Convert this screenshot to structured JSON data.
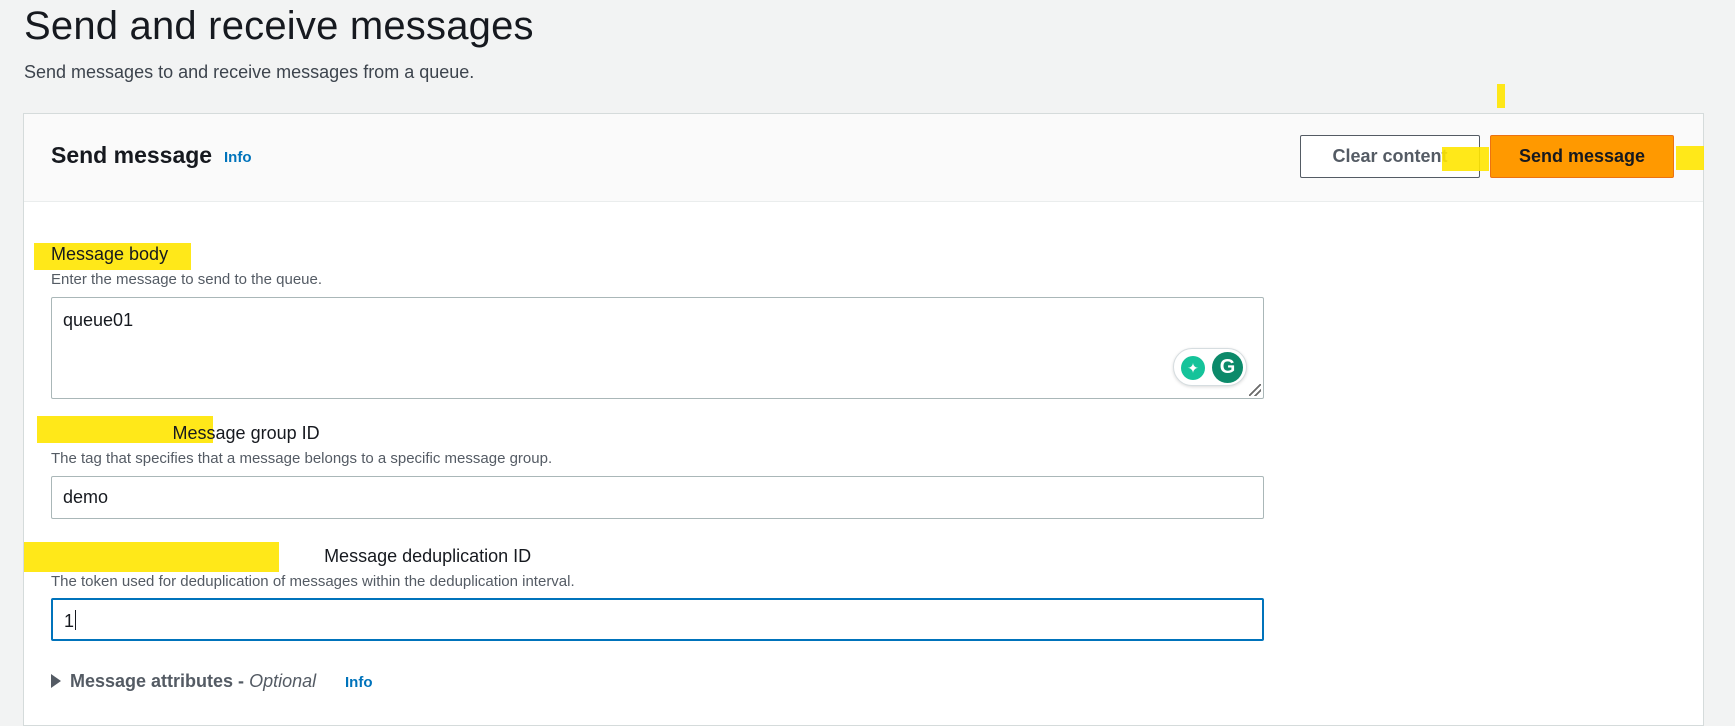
{
  "page": {
    "title": "Send and receive messages",
    "subtitle": "Send messages to and receive messages from a queue."
  },
  "panel": {
    "title": "Send message",
    "info_label": "Info",
    "clear_button": "Clear content",
    "send_button": "Send message"
  },
  "fields": {
    "message_body": {
      "label": "Message body",
      "description": "Enter the message to send to the queue.",
      "value": "queue01"
    },
    "group_id": {
      "label": "Message group ID",
      "description": "The tag that specifies that a message belongs to a specific message group.",
      "value": "demo"
    },
    "dedup_id": {
      "label": "Message deduplication ID",
      "description": "The token used for deduplication of messages within the deduplication interval.",
      "value": "1"
    }
  },
  "attributes": {
    "label": "Message attributes - ",
    "optional": "Optional",
    "info_label": "Info"
  },
  "icons": {
    "grammarly_suggest": "lightbulb-icon",
    "grammarly_logo": "grammarly-icon",
    "expand": "caret-right-icon"
  },
  "colors": {
    "accent": "#ff9900",
    "link": "#0073bb",
    "highlight": "#ffe600"
  }
}
